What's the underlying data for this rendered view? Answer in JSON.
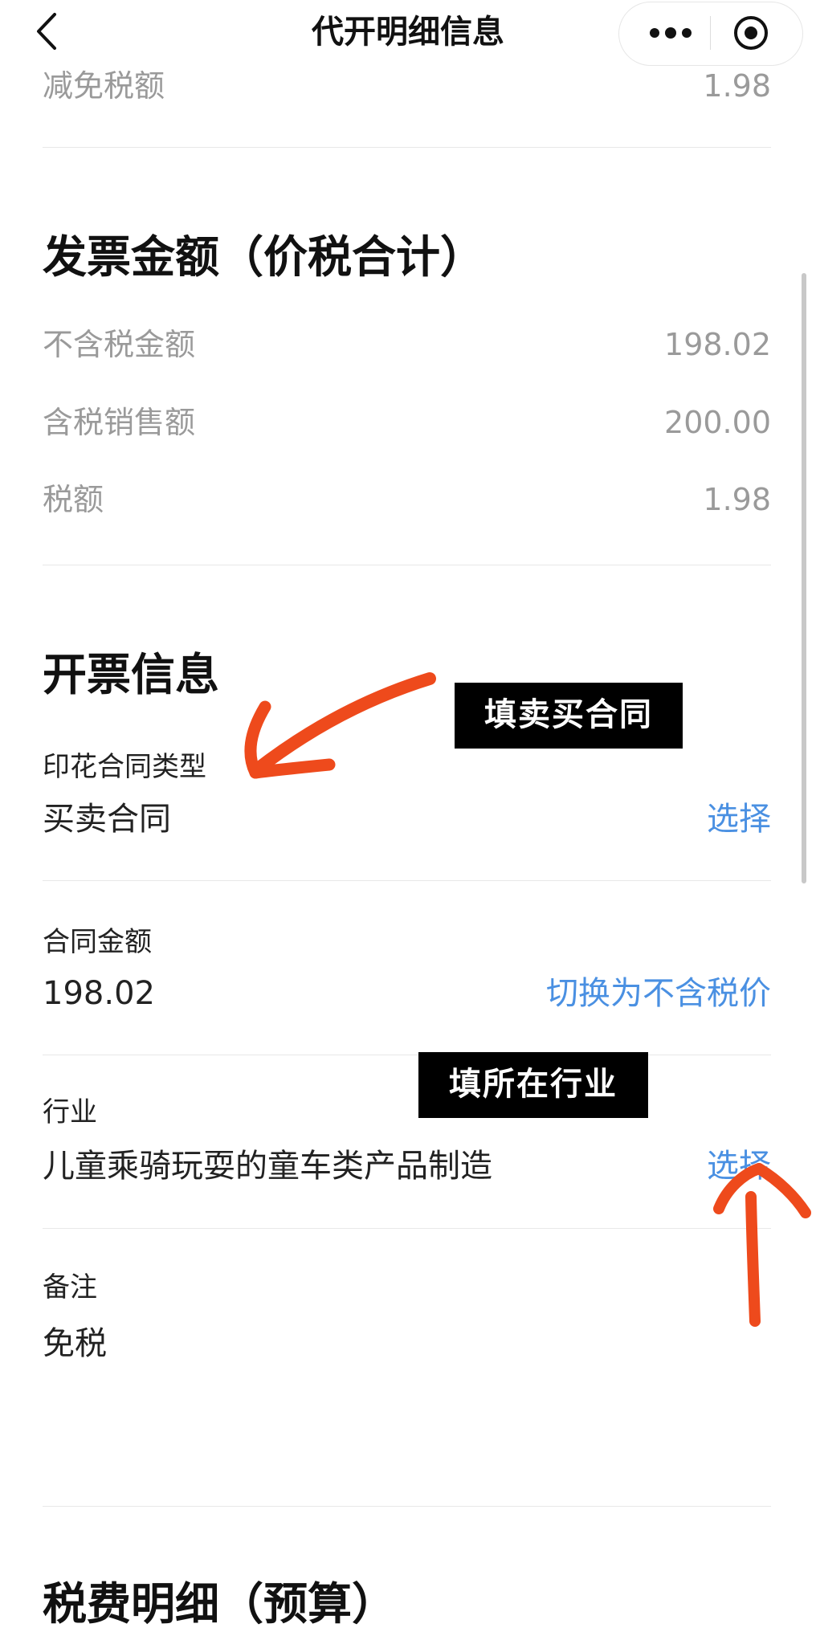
{
  "nav": {
    "title": "代开明细信息",
    "back_icon": "chevron-left-icon",
    "more_icon": "more-dots-icon",
    "capsule_close_icon": "target-circle-icon"
  },
  "tax_reduction": {
    "label": "减免税额",
    "value": "1.98"
  },
  "invoice_amount": {
    "title": "发票金额（价税合计）",
    "rows": [
      {
        "label": "不含税金额",
        "value": "198.02"
      },
      {
        "label": "含税销售额",
        "value": "200.00"
      },
      {
        "label": "税额",
        "value": "1.98"
      }
    ]
  },
  "invoice_info": {
    "title": "开票信息",
    "stamp_contract": {
      "label": "印花合同类型",
      "value": "买卖合同",
      "action": "选择"
    },
    "contract_amount": {
      "label": "合同金额",
      "value": "198.02",
      "action": "切换为不含税价"
    },
    "industry": {
      "label": "行业",
      "value": "儿童乘骑玩耍的童车类产品制造",
      "action": "选择"
    },
    "remark": {
      "label": "备注",
      "value": "免税"
    }
  },
  "fee_detail": {
    "title": "税费明细（预算）"
  },
  "annotations": {
    "note_contract": "填卖买合同",
    "note_industry": "填所在行业",
    "arrow_color": "#ee4a1c"
  },
  "colors": {
    "link": "#4a90e2",
    "muted": "#9a9a9a",
    "text": "#1a1a1a"
  }
}
